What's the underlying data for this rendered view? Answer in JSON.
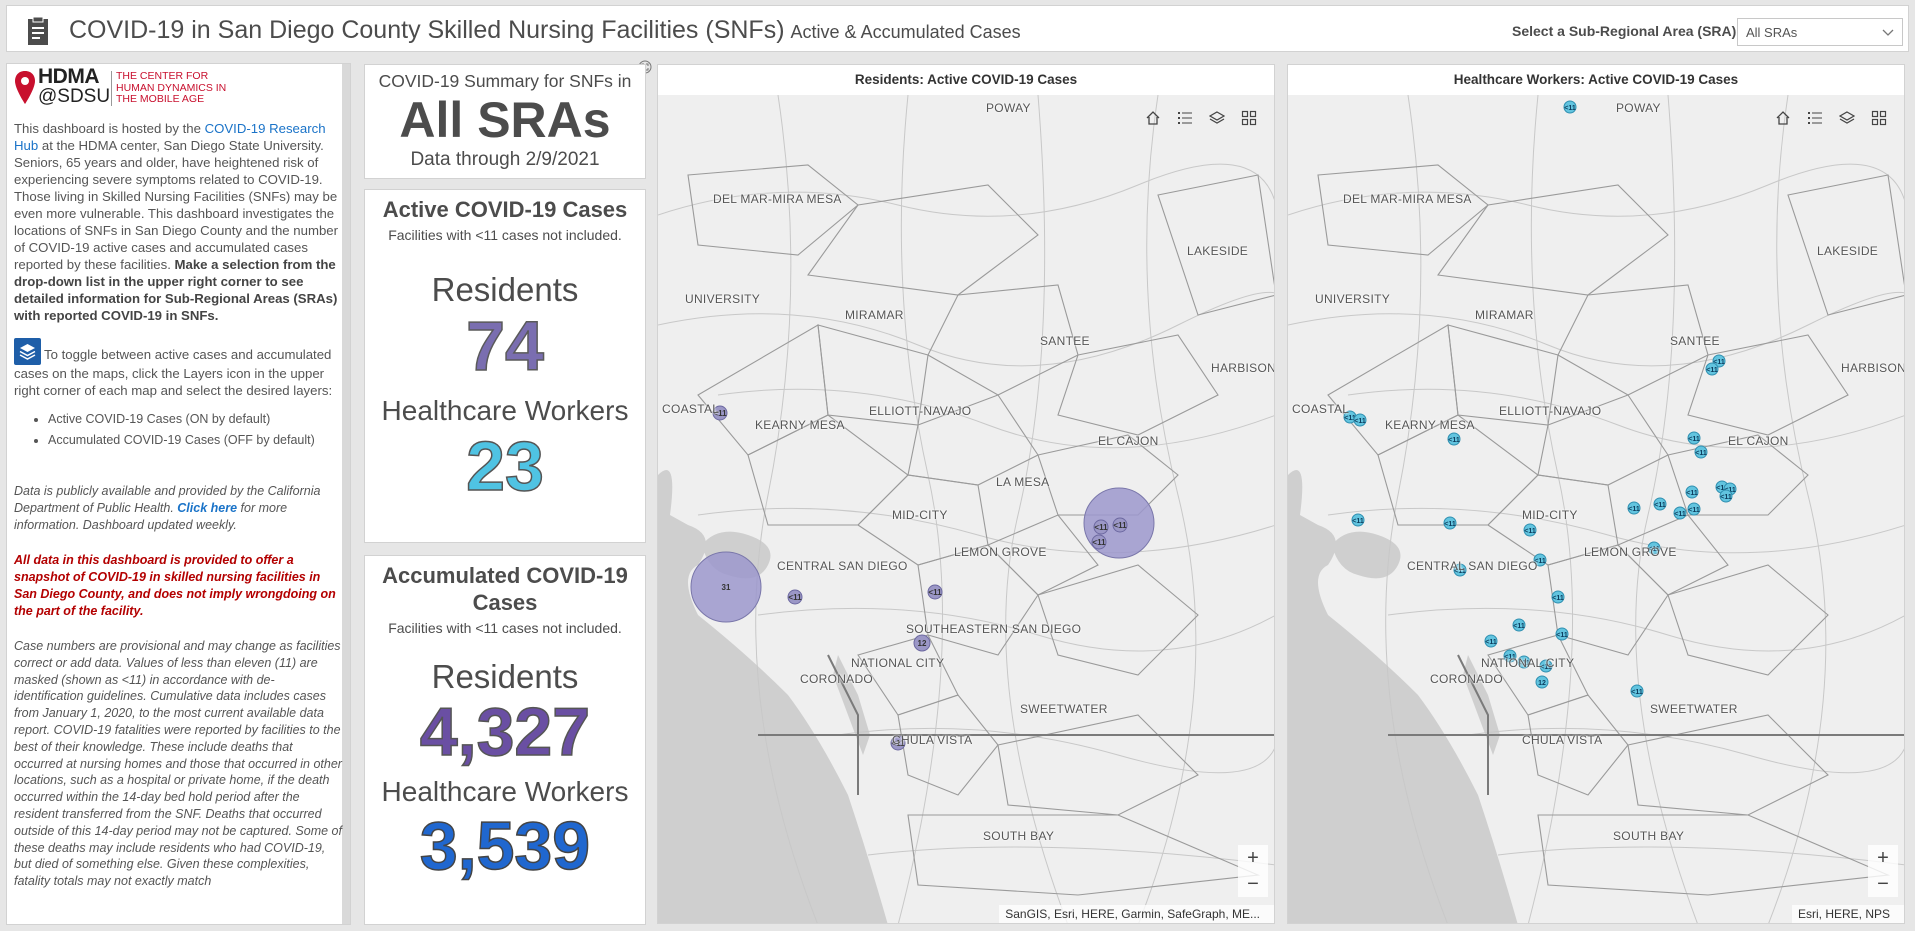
{
  "header": {
    "title": "COVID-19 in San Diego County Skilled Nursing Facilities (SNFs)",
    "subtitle": "Active & Accumulated Cases",
    "select_label": "Select a Sub-Regional Area (SRA):",
    "select_value": "All SRAs"
  },
  "sidebar": {
    "logo_hdma": "HDMA",
    "logo_sdsu": "@SDSU",
    "logo_center": "THE CENTER FOR HUMAN DYNAMICS IN THE MOBILE AGE",
    "intro_1": "This dashboard is hosted by the ",
    "intro_link": "COVID-19 Research Hub",
    "intro_2": " at the HDMA center, San Diego State University. Seniors, 65 years and older, have heightened risk of experiencing severe symptoms related to COVID-19. Those living in Skilled Nursing Facilities (SNFs) may be even more vulnerable. This dashboard investigates the locations of SNFs in San Diego County and the number of COVID-19 active cases and accumulated cases reported by these facilities. ",
    "intro_bold": "Make a selection from the drop-down list in the upper right corner to see detailed information for Sub-Regional Areas (SRAs) with reported COVID-19 in SNFs.",
    "toggle_text": "To toggle between active cases and accumulated cases on the maps, click the Layers icon in the upper right corner of each map and select the desired layers:",
    "layer_1": "Active COVID-19 Cases (ON by default)",
    "layer_2": "Accumulated COVID-19 Cases (OFF by default)",
    "note_1": "Data is publicly available and provided by the California Department of Public Health. ",
    "note_link": "Click here",
    "note_2": " for more information. Dashboard updated weekly.",
    "warning": "All data in this dashboard is provided to offer a snapshot of COVID-19 in skilled nursing facilities in San Diego County, and does not imply wrongdoing on the part of the facility.",
    "provisional": "Case numbers are provisional and may change as facilities correct or add data.  Values of less than eleven (11) are masked (shown as <11) in accordance with de-identification guidelines. Cumulative data includes cases from January 1, 2020, to the most current available data report. COVID-19 fatalities were reported by facilities to the best of their knowledge. These include deaths that occurred at nursing homes and those that occurred in other locations, such as a hospital or private home, if the death occurred within the 14-day bed hold period after the resident transferred from the SNF. Deaths that occurred outside of this 14-day period may not be captured. Some of these deaths may include residents who had COVID-19, but died of something else. Given these complexities, fatality totals may not exactly match"
  },
  "summary": {
    "line1": "COVID-19 Summary for SNFs in",
    "area": "All SRAs",
    "data_through": "Data through 2/9/2021"
  },
  "active": {
    "title": "Active COVID-19 Cases",
    "subtitle": "Facilities with <11 cases not included.",
    "residents_label": "Residents",
    "residents_value": "74",
    "workers_label": "Healthcare Workers",
    "workers_value": "23"
  },
  "accumulated": {
    "title": "Accumulated COVID-19 Cases",
    "subtitle": "Facilities with <11 cases not included.",
    "residents_label": "Residents",
    "residents_value": "4,327",
    "workers_label": "Healthcare Workers",
    "workers_value": "3,539"
  },
  "map_residents": {
    "title": "Residents: Active COVID-19 Cases",
    "attribution": "SanGIS, Esri, HERE, Garmin, SafeGraph, ME...",
    "places": [
      "POWAY",
      "DEL MAR-MIRA MESA",
      "LAKESIDE",
      "UNIVERSITY",
      "MIRAMAR",
      "SANTEE",
      "HARBISON",
      "COASTAL",
      "ELLIOTT-NAVAJO",
      "KEARNY MESA",
      "EL CAJON",
      "LA MESA",
      "MID-CITY",
      "LEMON GROVE",
      "CENTRAL SAN DIEGO",
      "SOUTHEASTERN SAN DIEGO",
      "NATIONAL CITY",
      "CORONADO",
      "SWEETWATER",
      "CHULA VISTA",
      "SOUTH BAY"
    ],
    "markers": [
      "<11",
      "31",
      "<11",
      "<11",
      "12",
      "<11",
      "<11",
      "<11",
      "<11",
      "<11"
    ]
  },
  "map_workers": {
    "title": "Healthcare Workers: Active COVID-19 Cases",
    "attribution": "Esri, HERE, NPS",
    "places": [
      "POWAY",
      "DEL MAR-MIRA MESA",
      "LAKESIDE",
      "UNIVERSITY",
      "MIRAMAR",
      "SANTEE",
      "HARBISON",
      "COASTAL",
      "ELLIOTT-NAVAJO",
      "KEARNY MESA",
      "EL CAJON",
      "MID-CITY",
      "LEMON GROVE",
      "CENTRAL SAN DIEGO",
      "NATIONAL CITY",
      "CORONADO",
      "SWEETWATER",
      "CHULA VISTA",
      "SOUTH BAY"
    ],
    "markers": [
      "<11",
      "<11",
      "<11",
      "<11",
      "<11",
      "<11",
      "<11",
      "<11",
      "<11",
      "<11",
      "<11",
      "<11",
      "<11",
      "<11",
      "<11",
      "<11",
      "<11",
      "<11",
      "<11",
      "<11",
      "<11",
      "<11",
      "<11",
      "<11",
      "<11",
      "<11",
      "<11",
      "<11",
      "<11",
      "12",
      "<11"
    ]
  },
  "zoom": {
    "in": "+",
    "out": "−"
  }
}
